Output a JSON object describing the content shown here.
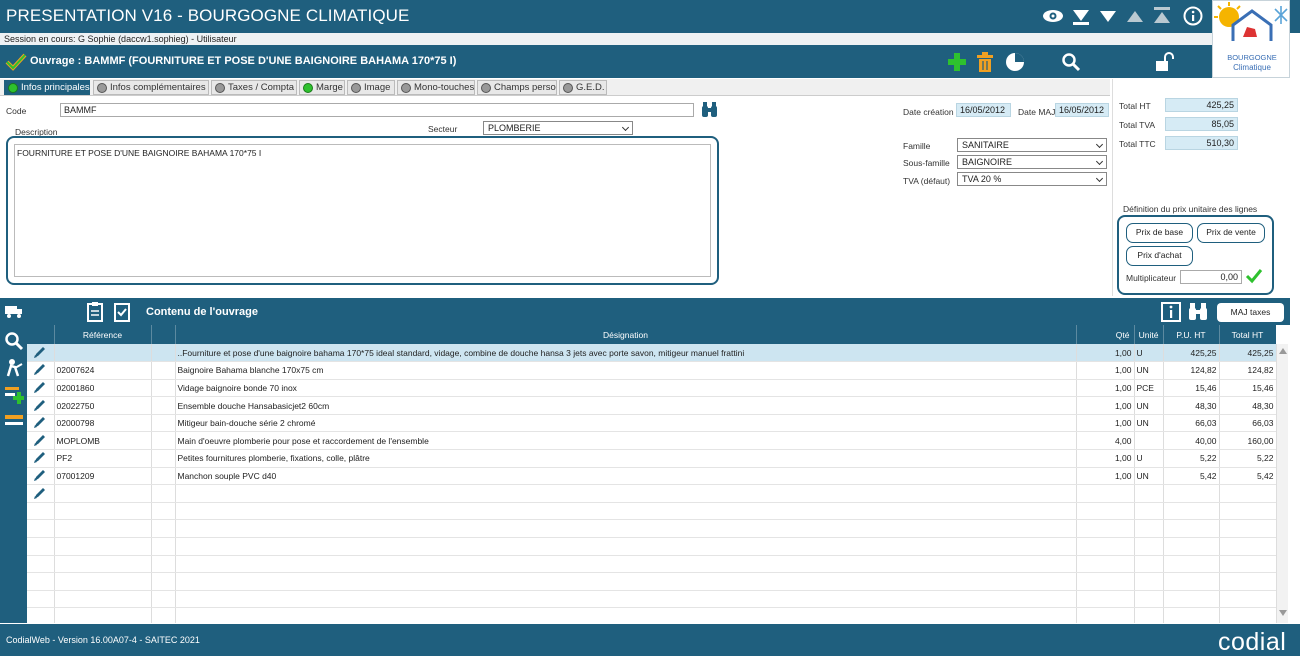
{
  "app": {
    "title": "PRESENTATION V16 - BOURGOGNE CLIMATIQUE",
    "session": "Session en cours: G           Sophie (daccw1.sophieg) - Utilisateur",
    "logo_line1": "BOURGOGNE",
    "logo_line2": "Climatique",
    "top_icons": [
      "eye-icon",
      "download-all-icon",
      "download-icon",
      "upload-icon",
      "upload-all-icon",
      "info-icon"
    ]
  },
  "header": {
    "title": "Ouvrage : BAMMF (FOURNITURE ET POSE D'UNE BAIGNOIRE BAHAMA 170*75 I)",
    "icons": [
      "add-icon",
      "trash-icon",
      "chart-icon",
      "search-icon",
      "unlock-icon"
    ]
  },
  "tabs": [
    {
      "label": "Infos principales",
      "status": "green"
    },
    {
      "label": "Infos complémentaires",
      "status": "grey"
    },
    {
      "label": "Taxes / Compta",
      "status": "grey"
    },
    {
      "label": "Marge",
      "status": "green"
    },
    {
      "label": "Image",
      "status": "grey"
    },
    {
      "label": "Mono-touches",
      "status": "grey"
    },
    {
      "label": "Champs perso",
      "status": "grey"
    },
    {
      "label": "G.E.D.",
      "status": "grey"
    }
  ],
  "form": {
    "code_label": "Code",
    "code_value": "BAMMF",
    "description_label": "Description",
    "description_value": "FOURNITURE ET POSE D'UNE BAIGNOIRE BAHAMA 170*75 I",
    "secteur_label": "Secteur",
    "secteur_value": "PLOMBERIE",
    "date_creation_label": "Date création",
    "date_creation_value": "16/05/2012",
    "date_maj_label": "Date MAJ",
    "date_maj_value": "16/05/2012",
    "famille_label": "Famille",
    "famille_value": "SANITAIRE",
    "sous_famille_label": "Sous-famille",
    "sous_famille_value": "BAIGNOIRE",
    "tva_label": "TVA (défaut)",
    "tva_value": "TVA 20 %"
  },
  "totals": {
    "ht_label": "Total HT",
    "ht_value": "425,25",
    "tva_label": "Total TVA",
    "tva_value": "85,05",
    "ttc_label": "Total TTC",
    "ttc_value": "510,30"
  },
  "prix": {
    "title": "Définition du prix unitaire des lignes",
    "btn_base": "Prix de base",
    "btn_vente": "Prix de vente",
    "btn_achat": "Prix d'achat",
    "multiplicateur_label": "Multiplicateur",
    "multiplicateur_value": "0,00"
  },
  "content": {
    "title": "Contenu de l'ouvrage",
    "maj_button": "MAJ taxes"
  },
  "grid": {
    "columns": [
      "",
      "Référence",
      "",
      "Désignation",
      "Qté",
      "Unité",
      "P.U. HT",
      "Total HT"
    ],
    "rows": [
      {
        "ref": "",
        "designation": "..Fourniture et pose d'une baignoire bahama 170*75 ideal standard, vidage, combine de douche hansa 3 jets avec porte savon, mitigeur manuel frattini",
        "qte": "1,00",
        "unite": "U",
        "pu": "425,25",
        "total": "425,25"
      },
      {
        "ref": "02007624",
        "designation": "Baignoire Bahama blanche 170x75 cm",
        "qte": "1,00",
        "unite": "UN",
        "pu": "124,82",
        "total": "124,82"
      },
      {
        "ref": "02001860",
        "designation": "Vidage baignoire bonde 70 inox",
        "qte": "1,00",
        "unite": "PCE",
        "pu": "15,46",
        "total": "15,46"
      },
      {
        "ref": "02022750",
        "designation": "Ensemble douche Hansabasicjet2 60cm",
        "qte": "1,00",
        "unite": "UN",
        "pu": "48,30",
        "total": "48,30"
      },
      {
        "ref": "02000798",
        "designation": "Mitigeur bain-douche série 2 chromé",
        "qte": "1,00",
        "unite": "UN",
        "pu": "66,03",
        "total": "66,03"
      },
      {
        "ref": "MOPLOMB",
        "designation": "Main d'oeuvre plomberie pour pose et raccordement de l'ensemble",
        "qte": "4,00",
        "unite": "",
        "pu": "40,00",
        "total": "160,00"
      },
      {
        "ref": "PF2",
        "designation": "Petites fournitures plomberie, fixations, colle, plâtre",
        "qte": "1,00",
        "unite": "U",
        "pu": "5,22",
        "total": "5,22"
      },
      {
        "ref": "07001209",
        "designation": "Manchon souple PVC d40",
        "qte": "1,00",
        "unite": "UN",
        "pu": "5,42",
        "total": "5,42"
      },
      {
        "ref": "",
        "designation": "",
        "qte": "",
        "unite": "",
        "pu": "",
        "total": ""
      }
    ]
  },
  "footer": {
    "version": "CodialWeb - Version 16.00A07-4 - SAITEC 2021",
    "brand": "codial"
  },
  "colors": {
    "primary": "#1f5f7e",
    "accent_green": "#2ec12e",
    "trash_orange": "#f0a022",
    "selected_row": "#cde5f1",
    "total_bg": "#d6ebf5"
  }
}
